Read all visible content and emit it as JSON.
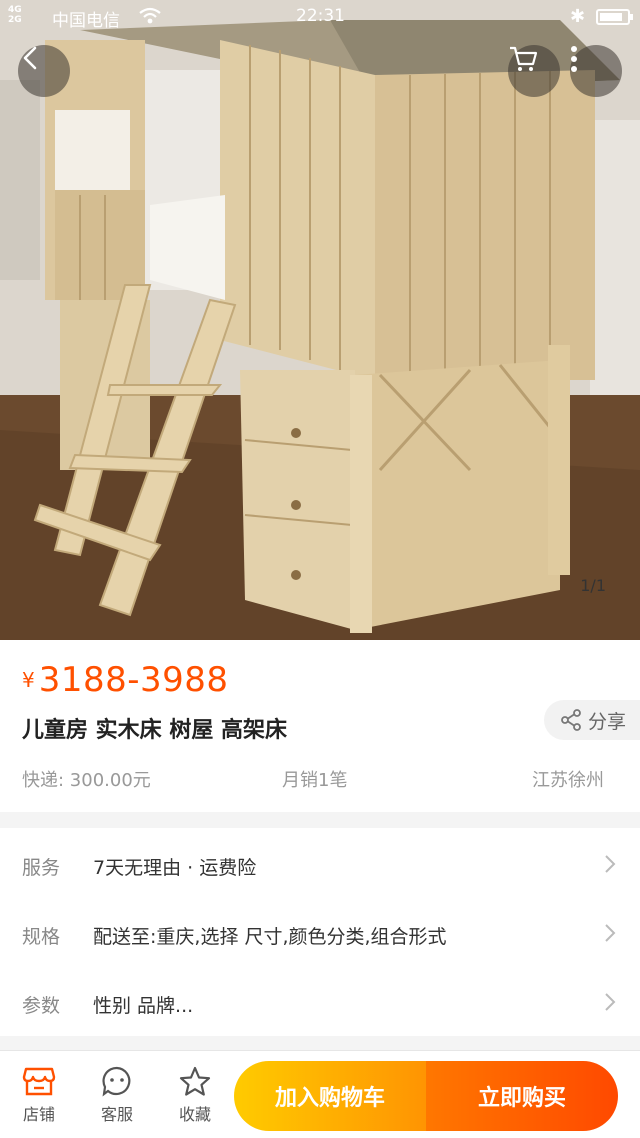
{
  "status_bar": {
    "network": "4G\n2G",
    "carrier": "中国电信",
    "time": "22:31",
    "battery_level": 0.85
  },
  "gallery": {
    "image_subject": "wooden-treehouse-loft-bed",
    "page_indicator": "1/1"
  },
  "product": {
    "currency": "¥",
    "price_range": "3188-3988",
    "title": "儿童房 实木床 树屋 高架床",
    "share_label": "分享",
    "shipping": "快递: 300.00元",
    "monthly_sales": "月销1笔",
    "location": "江苏徐州"
  },
  "specs": [
    {
      "label": "服务",
      "value": "7天无理由 · 运费险"
    },
    {
      "label": "规格",
      "value": "配送至:重庆,选择 尺寸,颜色分类,组合形式"
    },
    {
      "label": "参数",
      "value": "性别 品牌..."
    }
  ],
  "bottom_bar": {
    "store_label": "店铺",
    "service_label": "客服",
    "favorite_label": "收藏",
    "add_to_cart_label": "加入购物车",
    "buy_now_label": "立即购买"
  },
  "colors": {
    "accent": "#ff5000",
    "cart_button": "#ffa200",
    "buy_button": "#ff5000"
  },
  "icons": [
    "back-arrow-icon",
    "cart-icon",
    "more-icon",
    "share-icon",
    "chevron-right-icon",
    "store-icon",
    "chat-icon",
    "star-icon"
  ]
}
